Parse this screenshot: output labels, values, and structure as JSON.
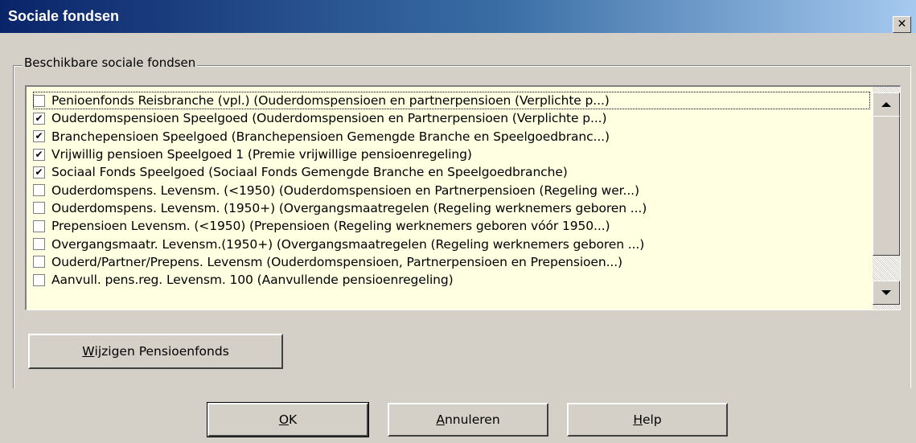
{
  "window": {
    "title": "Sociale fondsen",
    "close_glyph": "✕"
  },
  "group": {
    "label": "Beschikbare sociale fondsen"
  },
  "list": {
    "items": [
      {
        "label": "Penioenfonds Reisbranche (vpl.) (Ouderdomspensioen en partnerpensioen (Verplichte p...)",
        "checked": false
      },
      {
        "label": "Ouderdomspensioen Speelgoed (Ouderdomspensioen en Partnerpensioen (Verplichte p...)",
        "checked": true
      },
      {
        "label": "Branchepensioen Speelgoed (Branchepensioen Gemengde Branche en Speelgoedbranc...)",
        "checked": true
      },
      {
        "label": "Vrijwillig pensioen Speelgoed 1 (Premie vrijwillige pensioenregeling)",
        "checked": true
      },
      {
        "label": "Sociaal Fonds Speelgoed (Sociaal Fonds Gemengde Branche en Speelgoedbranche)",
        "checked": true
      },
      {
        "label": "Ouderdomspens. Levensm. (<1950) (Ouderdomspensioen en Partnerpensioen (Regeling wer...)",
        "checked": false
      },
      {
        "label": "Ouderdomspens. Levensm. (1950+) (Overgangsmaatregelen (Regeling werknemers geboren ...)",
        "checked": false
      },
      {
        "label": "Prepensioen Levensm. (<1950) (Prepensioen (Regeling werknemers geboren vóór 1950...)",
        "checked": false
      },
      {
        "label": "Overgangsmaatr. Levensm.(1950+) (Overgangsmaatregelen (Regeling werknemers geboren ...)",
        "checked": false
      },
      {
        "label": "Ouderd/Partner/Prepens. Levensm (Ouderdomspensioen,  Partnerpensioen en Prepensioen...)",
        "checked": false
      },
      {
        "label": "Aanvull. pens.reg. Levensm. 100 (Aanvullende pensioenregeling)",
        "checked": false
      }
    ],
    "check_glyph": "✔"
  },
  "buttons": {
    "wijzigen": {
      "mnemonic": "W",
      "rest": "ijzigen Pensioenfonds"
    },
    "ok": {
      "mnemonic": "O",
      "rest": "K"
    },
    "annuleren": {
      "mnemonic": "A",
      "rest": "nnuleren"
    },
    "help": {
      "mnemonic": "H",
      "rest": "elp"
    }
  }
}
